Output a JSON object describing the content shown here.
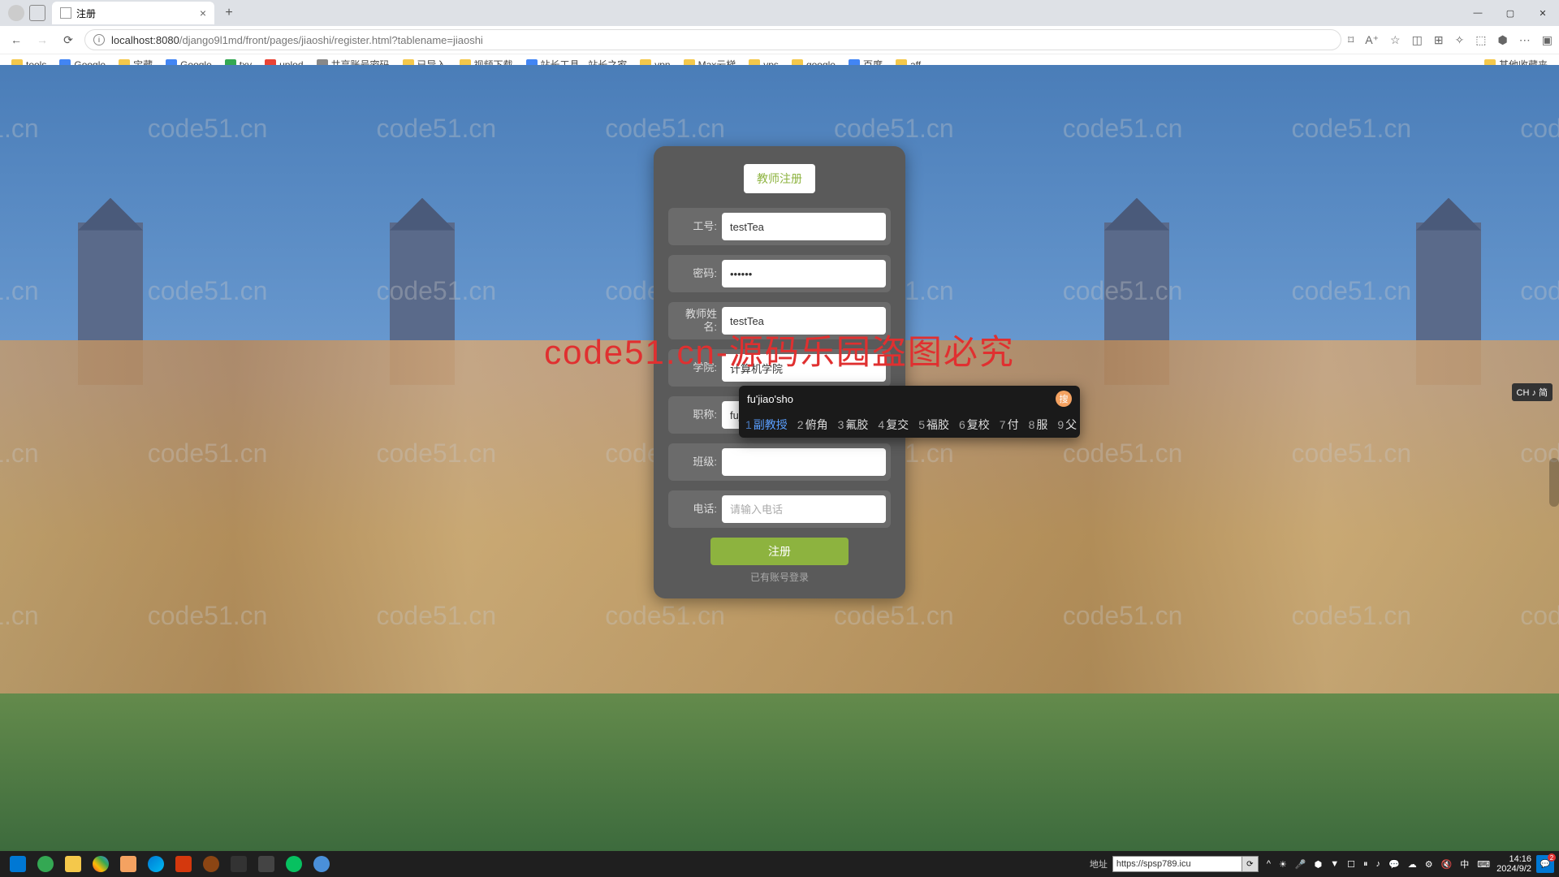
{
  "browser": {
    "tab_title": "注册",
    "url_host": "localhost:8080",
    "url_path": "/django9l1md/front/pages/jiaoshi/register.html?tablename=jiaoshi",
    "bookmarks": [
      "tools",
      "Google",
      "宝藏",
      "Google",
      "txy",
      "uplod",
      "共享账号密码",
      "已导入",
      "视频下载",
      "站长工具 - 站长之家",
      "vpn",
      "Max云梯",
      "vps",
      "google",
      "百度",
      "aff"
    ],
    "bookmark_more": "其他收藏夹"
  },
  "watermark": "code51.cn",
  "watermark_red": "code51.cn-源码乐园盗图必究",
  "form": {
    "title": "教师注册",
    "fields": {
      "gonghao": {
        "label": "工号:",
        "value": "testTea"
      },
      "mima": {
        "label": "密码:",
        "value": "••••••"
      },
      "xingming": {
        "label": "教师姓名:",
        "value": "testTea"
      },
      "xueyuan": {
        "label": "学院:",
        "value": "计算机学院"
      },
      "zhicheng": {
        "label": "职称:",
        "value": "fujiaosho"
      },
      "banji": {
        "label": "班级:",
        "value": ""
      },
      "dianhua": {
        "label": "电话:",
        "value": "",
        "placeholder": "请输入电话"
      }
    },
    "submit": "注册",
    "login_link": "已有账号登录"
  },
  "ime": {
    "composition": "fu'jiao'sho",
    "indicator": "CH ♪ 简",
    "candidates": [
      {
        "num": "1",
        "text": "副教授",
        "selected": true
      },
      {
        "num": "2",
        "text": "俯角"
      },
      {
        "num": "3",
        "text": "氟胶"
      },
      {
        "num": "4",
        "text": "复交"
      },
      {
        "num": "5",
        "text": "福胶"
      },
      {
        "num": "6",
        "text": "复校"
      },
      {
        "num": "7",
        "text": "付"
      },
      {
        "num": "8",
        "text": "服"
      },
      {
        "num": "9",
        "text": "父"
      }
    ]
  },
  "taskbar": {
    "addr_label": "地址",
    "addr_value": "https://spsp789.icu",
    "time": "14:16",
    "date": "2024/9/2"
  }
}
